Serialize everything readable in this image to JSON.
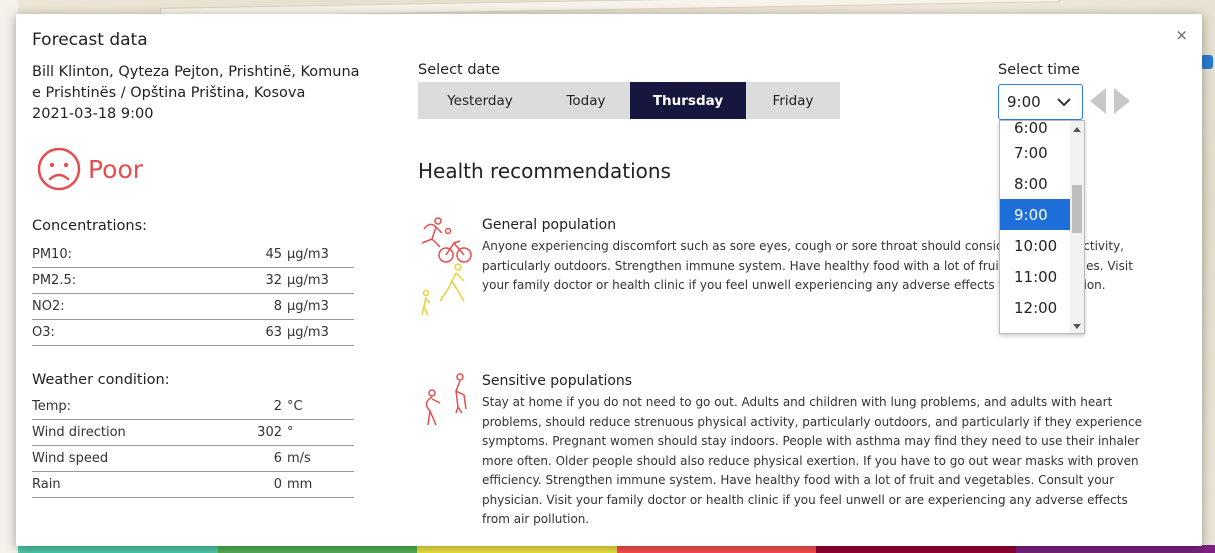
{
  "modal": {
    "title": "Forecast data",
    "close_label": "×",
    "address": "Bill Klinton, Qyteza Pejton, Prishtinë, Komuna e Prishtinës / Opština Priština, Kosova",
    "datetime": "2021-03-18 9:00",
    "quality": {
      "label": "Poor",
      "color": "#e84d4d",
      "icon": "sad-face-icon"
    }
  },
  "concentrations": {
    "title": "Concentrations:",
    "rows": [
      {
        "name": "PM10:",
        "value": "45",
        "unit": "μg/m3"
      },
      {
        "name": "PM2.5:",
        "value": "32",
        "unit": "μg/m3"
      },
      {
        "name": "NO2:",
        "value": "8",
        "unit": "μg/m3"
      },
      {
        "name": "O3:",
        "value": "63",
        "unit": "μg/m3"
      }
    ]
  },
  "weather": {
    "title": "Weather condition:",
    "rows": [
      {
        "name": "Temp:",
        "value": "2",
        "unit": "°C"
      },
      {
        "name": "Wind direction",
        "value": "302",
        "unit": "°"
      },
      {
        "name": "Wind speed",
        "value": "6",
        "unit": "m/s"
      },
      {
        "name": "Rain",
        "value": "0",
        "unit": "mm"
      }
    ]
  },
  "date_select": {
    "label": "Select date",
    "tabs": [
      "Yesterday",
      "Today",
      "Thursday",
      "Friday"
    ],
    "active": "Thursday"
  },
  "time_select": {
    "label": "Select time",
    "value": "9:00",
    "options": [
      "6:00",
      "7:00",
      "8:00",
      "9:00",
      "10:00",
      "11:00",
      "12:00"
    ]
  },
  "health": {
    "title": "Health recommendations",
    "recommendations": [
      {
        "title": "General population",
        "text": "Anyone experiencing discomfort such as sore eyes, cough or sore throat should consider reducing activity, particularly outdoors. Strengthen immune system. Have healthy food with a lot of fruit and vegetables. Visit your family doctor or health clinic if you feel unwell experiencing any adverse effects from air pollution."
      },
      {
        "title": "Sensitive populations",
        "text": "Stay at home if you do not need to go out. Adults and children with lung problems, and adults with heart problems, should reduce strenuous physical activity, particularly outdoors, and particularly if they experience symptoms. Pregnant women should stay indoors. People with asthma may find they need to use their inhaler more often. Older people should also reduce physical exertion. If you have to go out wear masks with proven efficiency. Strengthen immune system. Have healthy food with a lot of fruit and vegetables. Consult your physician. Visit your family doctor or health clinic if you feel unwell or are experiencing any adverse effects from air pollution."
      }
    ]
  },
  "legend": {
    "colors": [
      "#50ccaa",
      "#50b450",
      "#f0e641",
      "#ff5050",
      "#960032",
      "#7d2181"
    ]
  },
  "colors": {
    "active_tab": "#17163f",
    "selected_option": "#1e6fd9",
    "poor": "#e84d4d",
    "general_icon_red": "#e84d4d",
    "general_icon_yellow": "#e8d23a"
  }
}
